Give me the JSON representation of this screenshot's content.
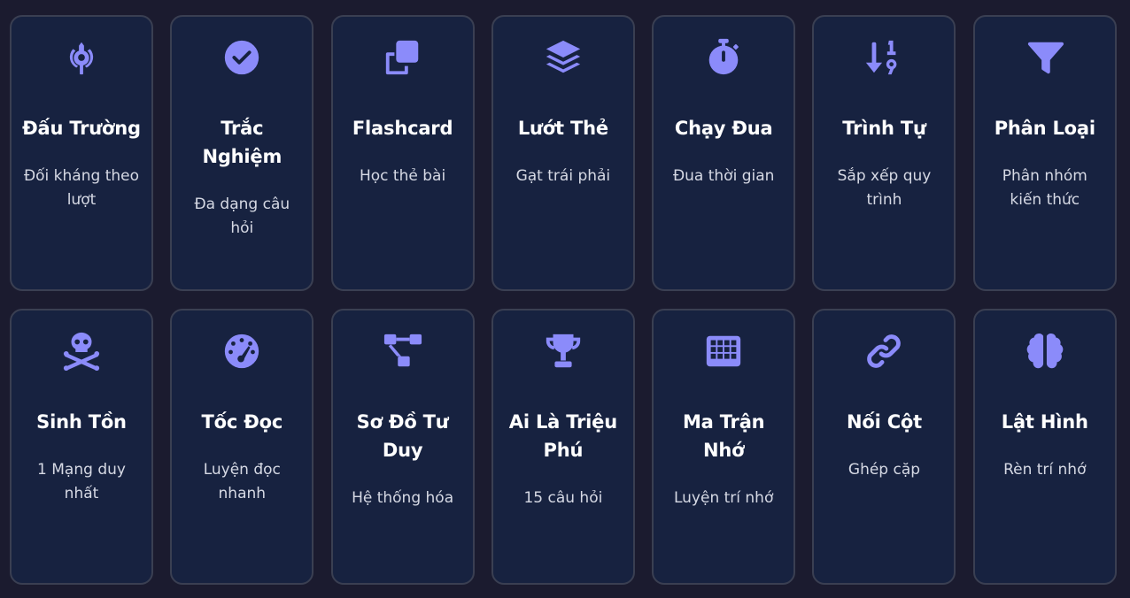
{
  "accent_color": "#8b8bfa",
  "cards": [
    {
      "icon": "khanda-icon",
      "title": "Đấu Trường",
      "desc": "Đối kháng theo lượt"
    },
    {
      "icon": "check-circle-icon",
      "title": "Trắc Nghiệm",
      "desc": "Đa dạng câu hỏi"
    },
    {
      "icon": "clone-icon",
      "title": "Flashcard",
      "desc": "Học thẻ bài"
    },
    {
      "icon": "layer-group-icon",
      "title": "Lướt Thẻ",
      "desc": "Gạt trái phải"
    },
    {
      "icon": "stopwatch-icon",
      "title": "Chạy Đua",
      "desc": "Đua thời gian"
    },
    {
      "icon": "sort-numeric-down-icon",
      "title": "Trình Tự",
      "desc": "Sắp xếp quy trình"
    },
    {
      "icon": "filter-icon",
      "title": "Phân Loại",
      "desc": "Phân nhóm kiến thức"
    },
    {
      "icon": "skull-crossbones-icon",
      "title": "Sinh Tồn",
      "desc": "1 Mạng duy nhất"
    },
    {
      "icon": "gauge-icon",
      "title": "Tốc Đọc",
      "desc": "Luyện đọc nhanh"
    },
    {
      "icon": "diagram-icon",
      "title": "Sơ Đồ Tư Duy",
      "desc": "Hệ thống hóa"
    },
    {
      "icon": "trophy-icon",
      "title": "Ai Là Triệu Phú",
      "desc": "15 câu hỏi"
    },
    {
      "icon": "grid-icon",
      "title": "Ma Trận Nhớ",
      "desc": "Luyện trí nhớ"
    },
    {
      "icon": "link-icon",
      "title": "Nối Cột",
      "desc": "Ghép cặp"
    },
    {
      "icon": "brain-icon",
      "title": "Lật Hình",
      "desc": "Rèn trí nhớ"
    }
  ]
}
